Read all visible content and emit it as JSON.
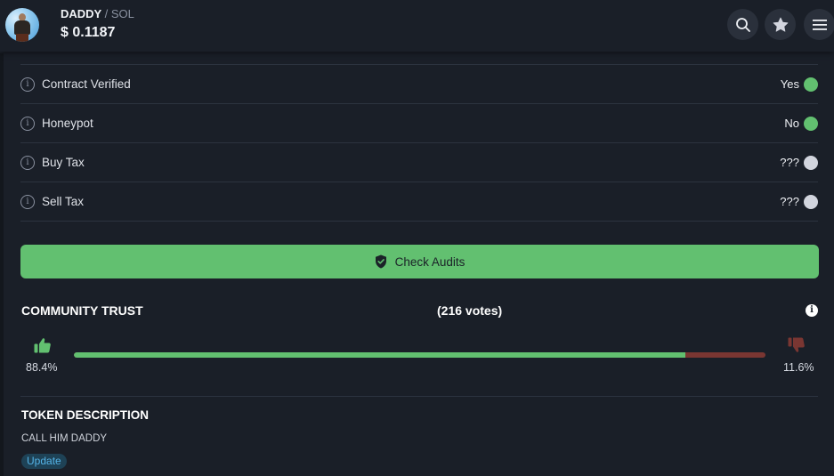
{
  "header": {
    "token_symbol": "DADDY",
    "separator": "/",
    "quote_symbol": "SOL",
    "price": "$ 0.1187",
    "avatar_alt": "token-avatar",
    "buttons": {
      "search_icon": "search-icon",
      "favorite_icon": "star-icon",
      "menu_icon": "hamburger-menu-icon"
    }
  },
  "security": {
    "rows": [
      {
        "label": "Contract Verified",
        "value": "Yes",
        "status": "green"
      },
      {
        "label": "Honeypot",
        "value": "No",
        "status": "green"
      },
      {
        "label": "Buy Tax",
        "value": "???",
        "status": "gray"
      },
      {
        "label": "Sell Tax",
        "value": "???",
        "status": "gray"
      }
    ],
    "status_colors": {
      "green": "#62c070",
      "gray": "#d2d5de"
    }
  },
  "audit_button": {
    "label": "Check Audits",
    "icon": "shield-check-icon"
  },
  "community_trust": {
    "title": "COMMUNITY TRUST",
    "votes": "(216 votes)",
    "up_percent_label": "88.4%",
    "down_percent_label": "11.6%",
    "up_fraction": 0.884,
    "colors": {
      "up": "#62c070",
      "down": "#7a3632"
    }
  },
  "token_description": {
    "title": "TOKEN DESCRIPTION",
    "text": "CALL HIM DADDY",
    "update_label": "Update"
  }
}
